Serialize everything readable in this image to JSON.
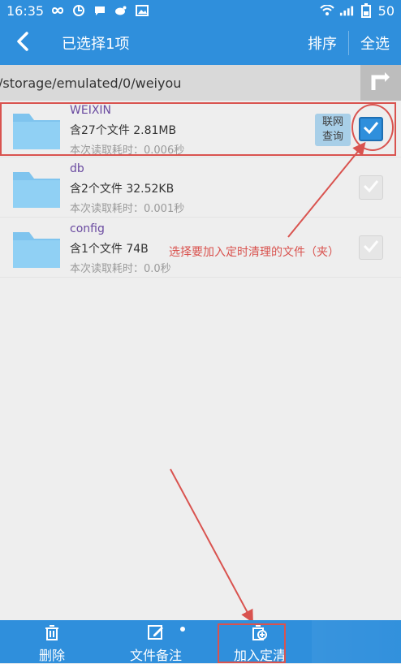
{
  "status_bar": {
    "time": "16:35",
    "battery": "50",
    "icons": [
      "infinity-icon",
      "sync-icon",
      "chat-icon",
      "weibo-icon",
      "image-icon",
      "wifi-icon",
      "signal-icon",
      "battery-icon"
    ]
  },
  "app_bar": {
    "title": "已选择1项",
    "sort_label": "排序",
    "select_all_label": "全选"
  },
  "path_bar": {
    "path": "/storage/emulated/0/weiyou"
  },
  "files": [
    {
      "name": "WEIXIN",
      "info": "含27个文件  2.81MB",
      "time": "本次读取耗时：0.006秒",
      "checked": true,
      "query_label_line1": "联网",
      "query_label_line2": "查询"
    },
    {
      "name": "db",
      "info": "含2个文件  32.52KB",
      "time": "本次读取耗时：0.001秒",
      "checked": false
    },
    {
      "name": "config",
      "info": "含1个文件  74B",
      "time": "本次读取耗时：0.0秒",
      "checked": false
    }
  ],
  "annotation": {
    "text": "选择要加入定时清理的文件（夹）",
    "accent_color": "#d9534f"
  },
  "bottom_bar": {
    "items": [
      {
        "label": "删除",
        "icon": "trash-icon"
      },
      {
        "label": "文件备注",
        "icon": "edit-icon"
      },
      {
        "label": "加入定清",
        "icon": "add-timer-icon"
      }
    ]
  },
  "colors": {
    "primary": "#2f8fdc",
    "background": "#eeeeee",
    "folder": "#7fc4ee"
  }
}
